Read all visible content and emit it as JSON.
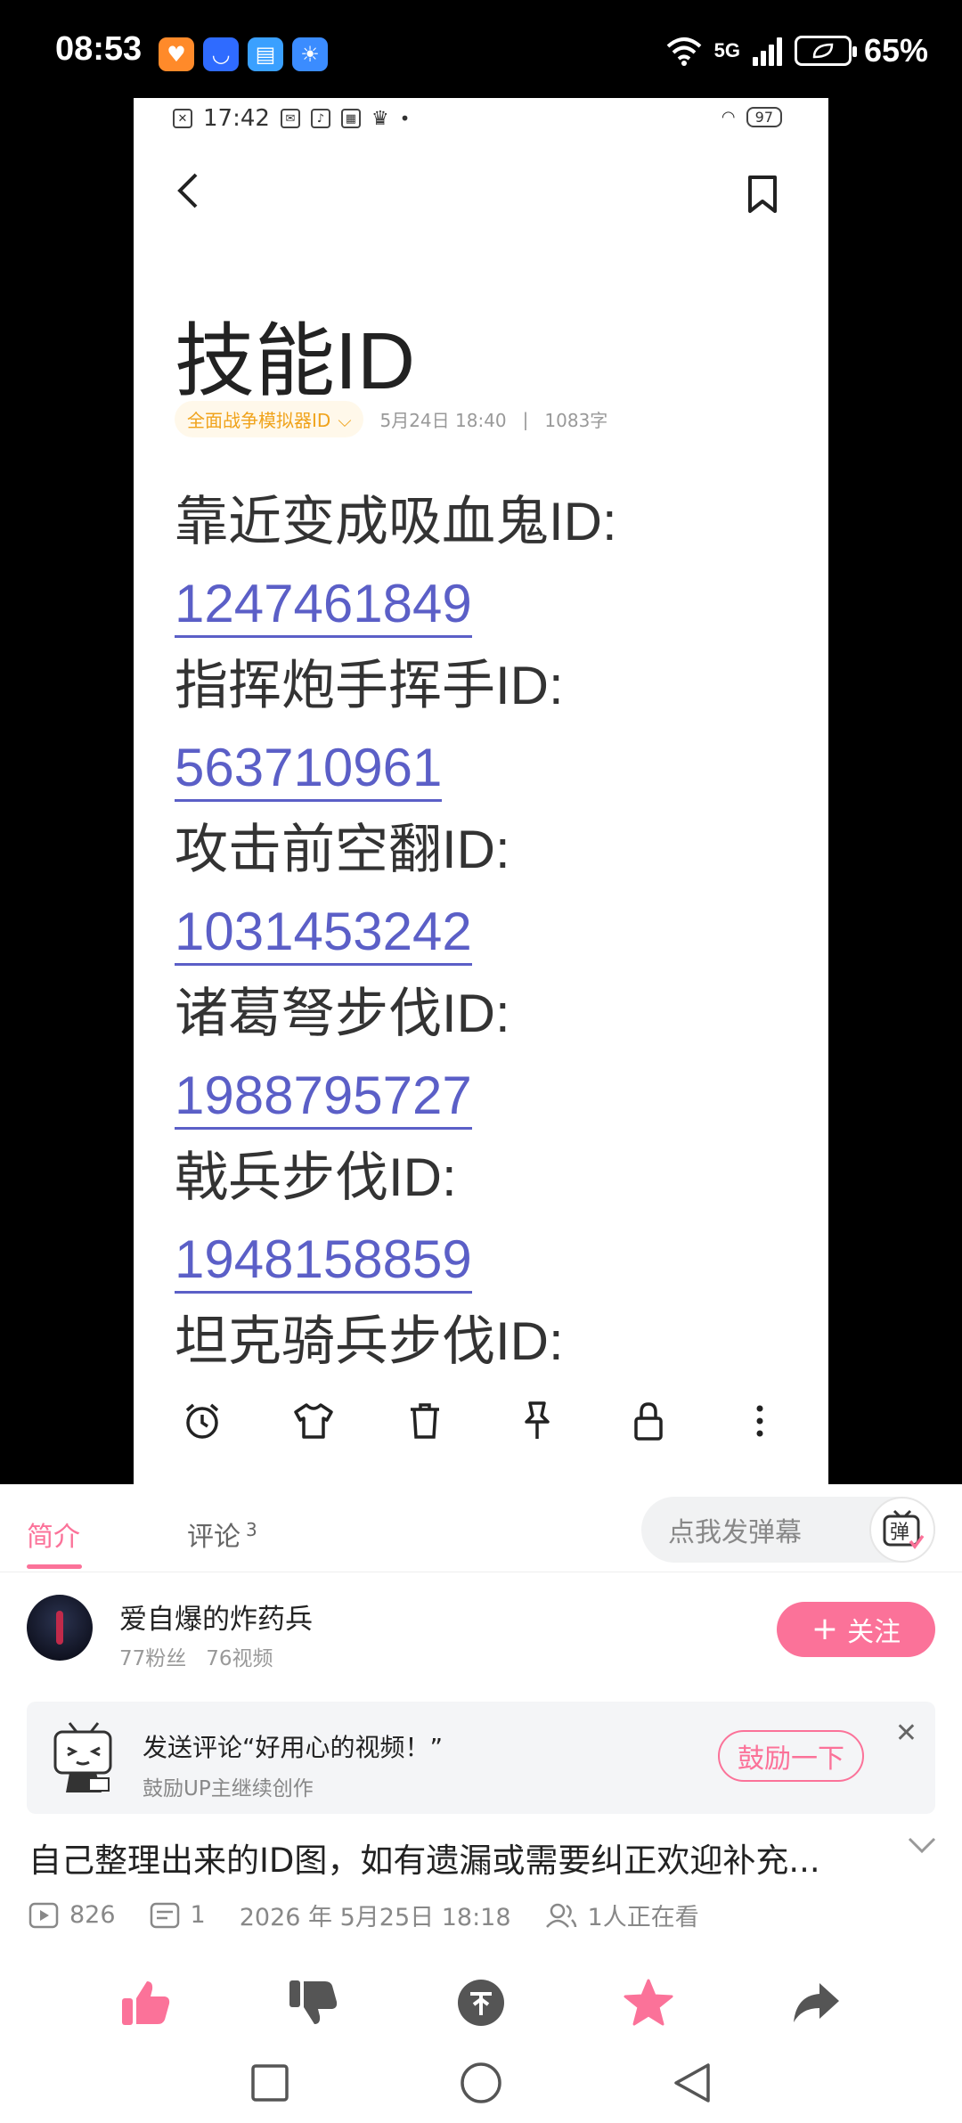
{
  "status_bar": {
    "time": "08:53",
    "network": "5G",
    "battery": "65%",
    "apps": [
      {
        "icon": "heart-app-icon",
        "color": "#ff8a2a"
      },
      {
        "icon": "shopping-app-icon",
        "color": "#2f6bff"
      },
      {
        "icon": "book-app-icon",
        "color": "#3aa0ff"
      },
      {
        "icon": "weather-app-icon",
        "color": "#3b8cff"
      }
    ]
  },
  "video_frame": {
    "inner_status": {
      "time": "17:42",
      "battery": "97"
    },
    "note_title": "技能ID",
    "tag": "全面战争模拟器ID",
    "date": "5月24日 18:40",
    "word_count": "1083字",
    "entries": [
      {
        "label": "靠近变成吸血鬼ID:",
        "id": "1247461849"
      },
      {
        "label": "指挥炮手挥手ID:",
        "id": "563710961"
      },
      {
        "label": "攻击前空翻ID:",
        "id": "1031453242"
      },
      {
        "label": "诸葛弩步伐ID:",
        "id": "1988795727"
      },
      {
        "label": "戟兵步伐ID:",
        "id": "1948158859"
      }
    ],
    "cut_off_label": "坦克骑兵步伐ID:",
    "toolbar_icons": [
      "alarm-icon",
      "shirt-icon",
      "trash-icon",
      "pin-icon",
      "lock-icon",
      "more-icon"
    ]
  },
  "tabs": {
    "intro": "简介",
    "comments": "评论",
    "comments_count": "3"
  },
  "danmaku": {
    "placeholder": "点我发弹幕",
    "button": "弹"
  },
  "uploader": {
    "name": "爱自爆的炸药兵",
    "fans": "77粉丝",
    "videos": "76视频",
    "follow_label": "关注"
  },
  "promo": {
    "title": "发送评论“好用心的视频！”",
    "subtitle": "鼓励UP主继续创作",
    "button": "鼓励一下"
  },
  "video_info": {
    "description": "自己整理出来的ID图，如有遗漏或需要纠正欢迎补充...",
    "views": "826",
    "danmaku_count": "1",
    "publish_time": "2026 年 5月25日 18:18",
    "watching": "1人正在看"
  },
  "colors": {
    "accent": "#fb7299",
    "link": "#5b5fc7",
    "tag": "#f0a31c",
    "dislike": "#555555",
    "coin": "#555555",
    "favorite": "#fb7299",
    "share": "#555555"
  }
}
